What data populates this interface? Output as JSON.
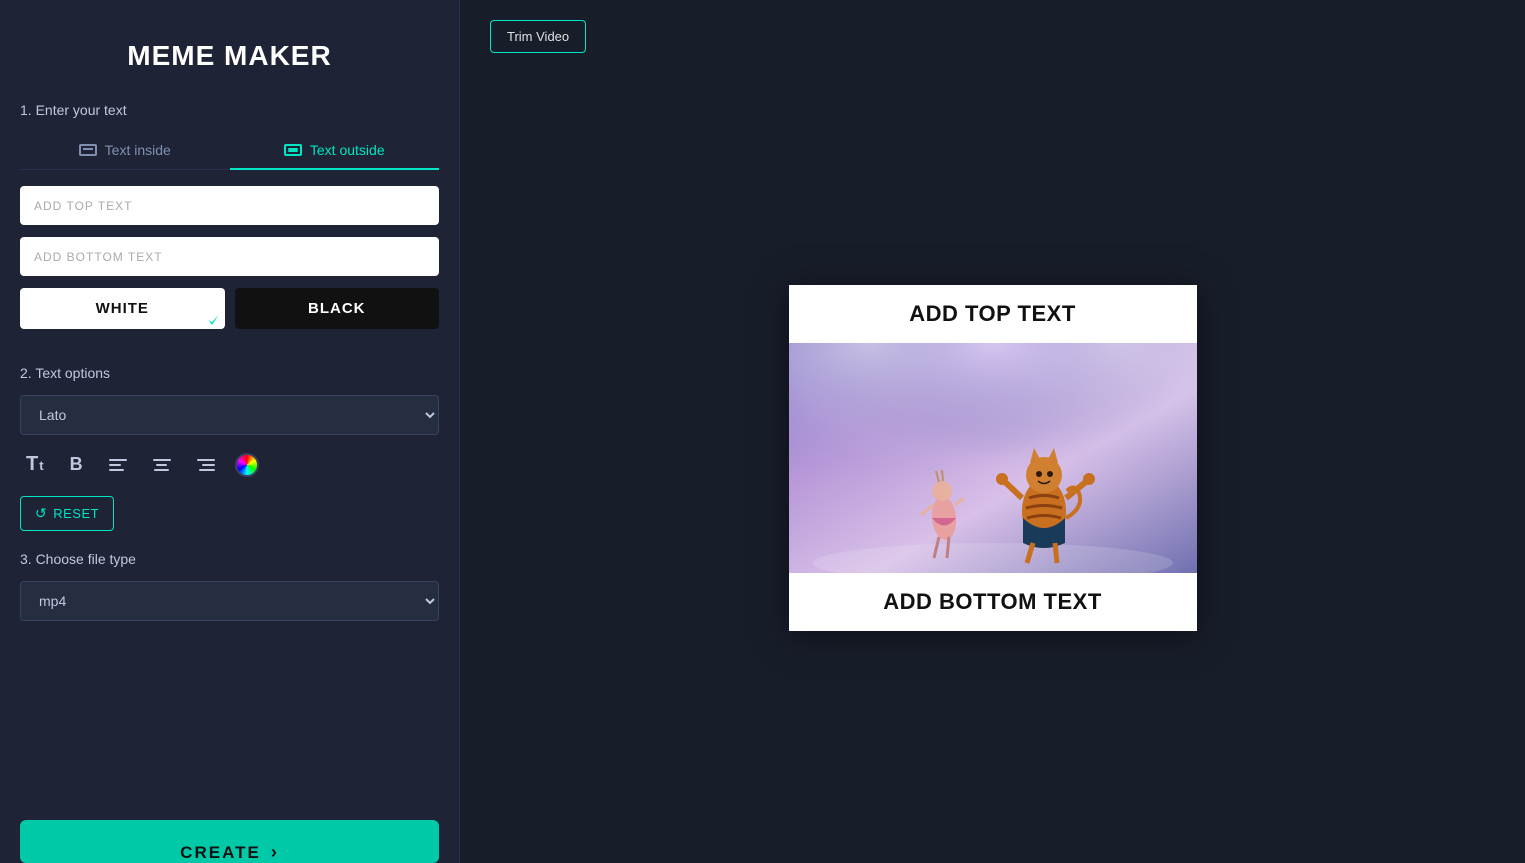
{
  "app": {
    "title": "MEME MAKER"
  },
  "sidebar": {
    "step1_label": "1. Enter your text",
    "step2_label": "2. Text options",
    "step3_label": "3. Choose file type",
    "tab_text_inside": "Text inside",
    "tab_text_outside": "Text outside",
    "top_text_placeholder": "ADD TOP TEXT",
    "bottom_text_placeholder": "ADD BOTTOM TEXT",
    "top_text_value": "",
    "bottom_text_value": "",
    "color_white_label": "WHITE",
    "color_black_label": "BLACK",
    "font_value": "Lato",
    "reset_label": "RESET",
    "file_type_value": "mp4",
    "create_label": "CREATE"
  },
  "header": {
    "trim_video_label": "Trim Video"
  },
  "preview": {
    "top_text": "ADD TOP TEXT",
    "bottom_text": "ADD BOTTOM TEXT"
  }
}
